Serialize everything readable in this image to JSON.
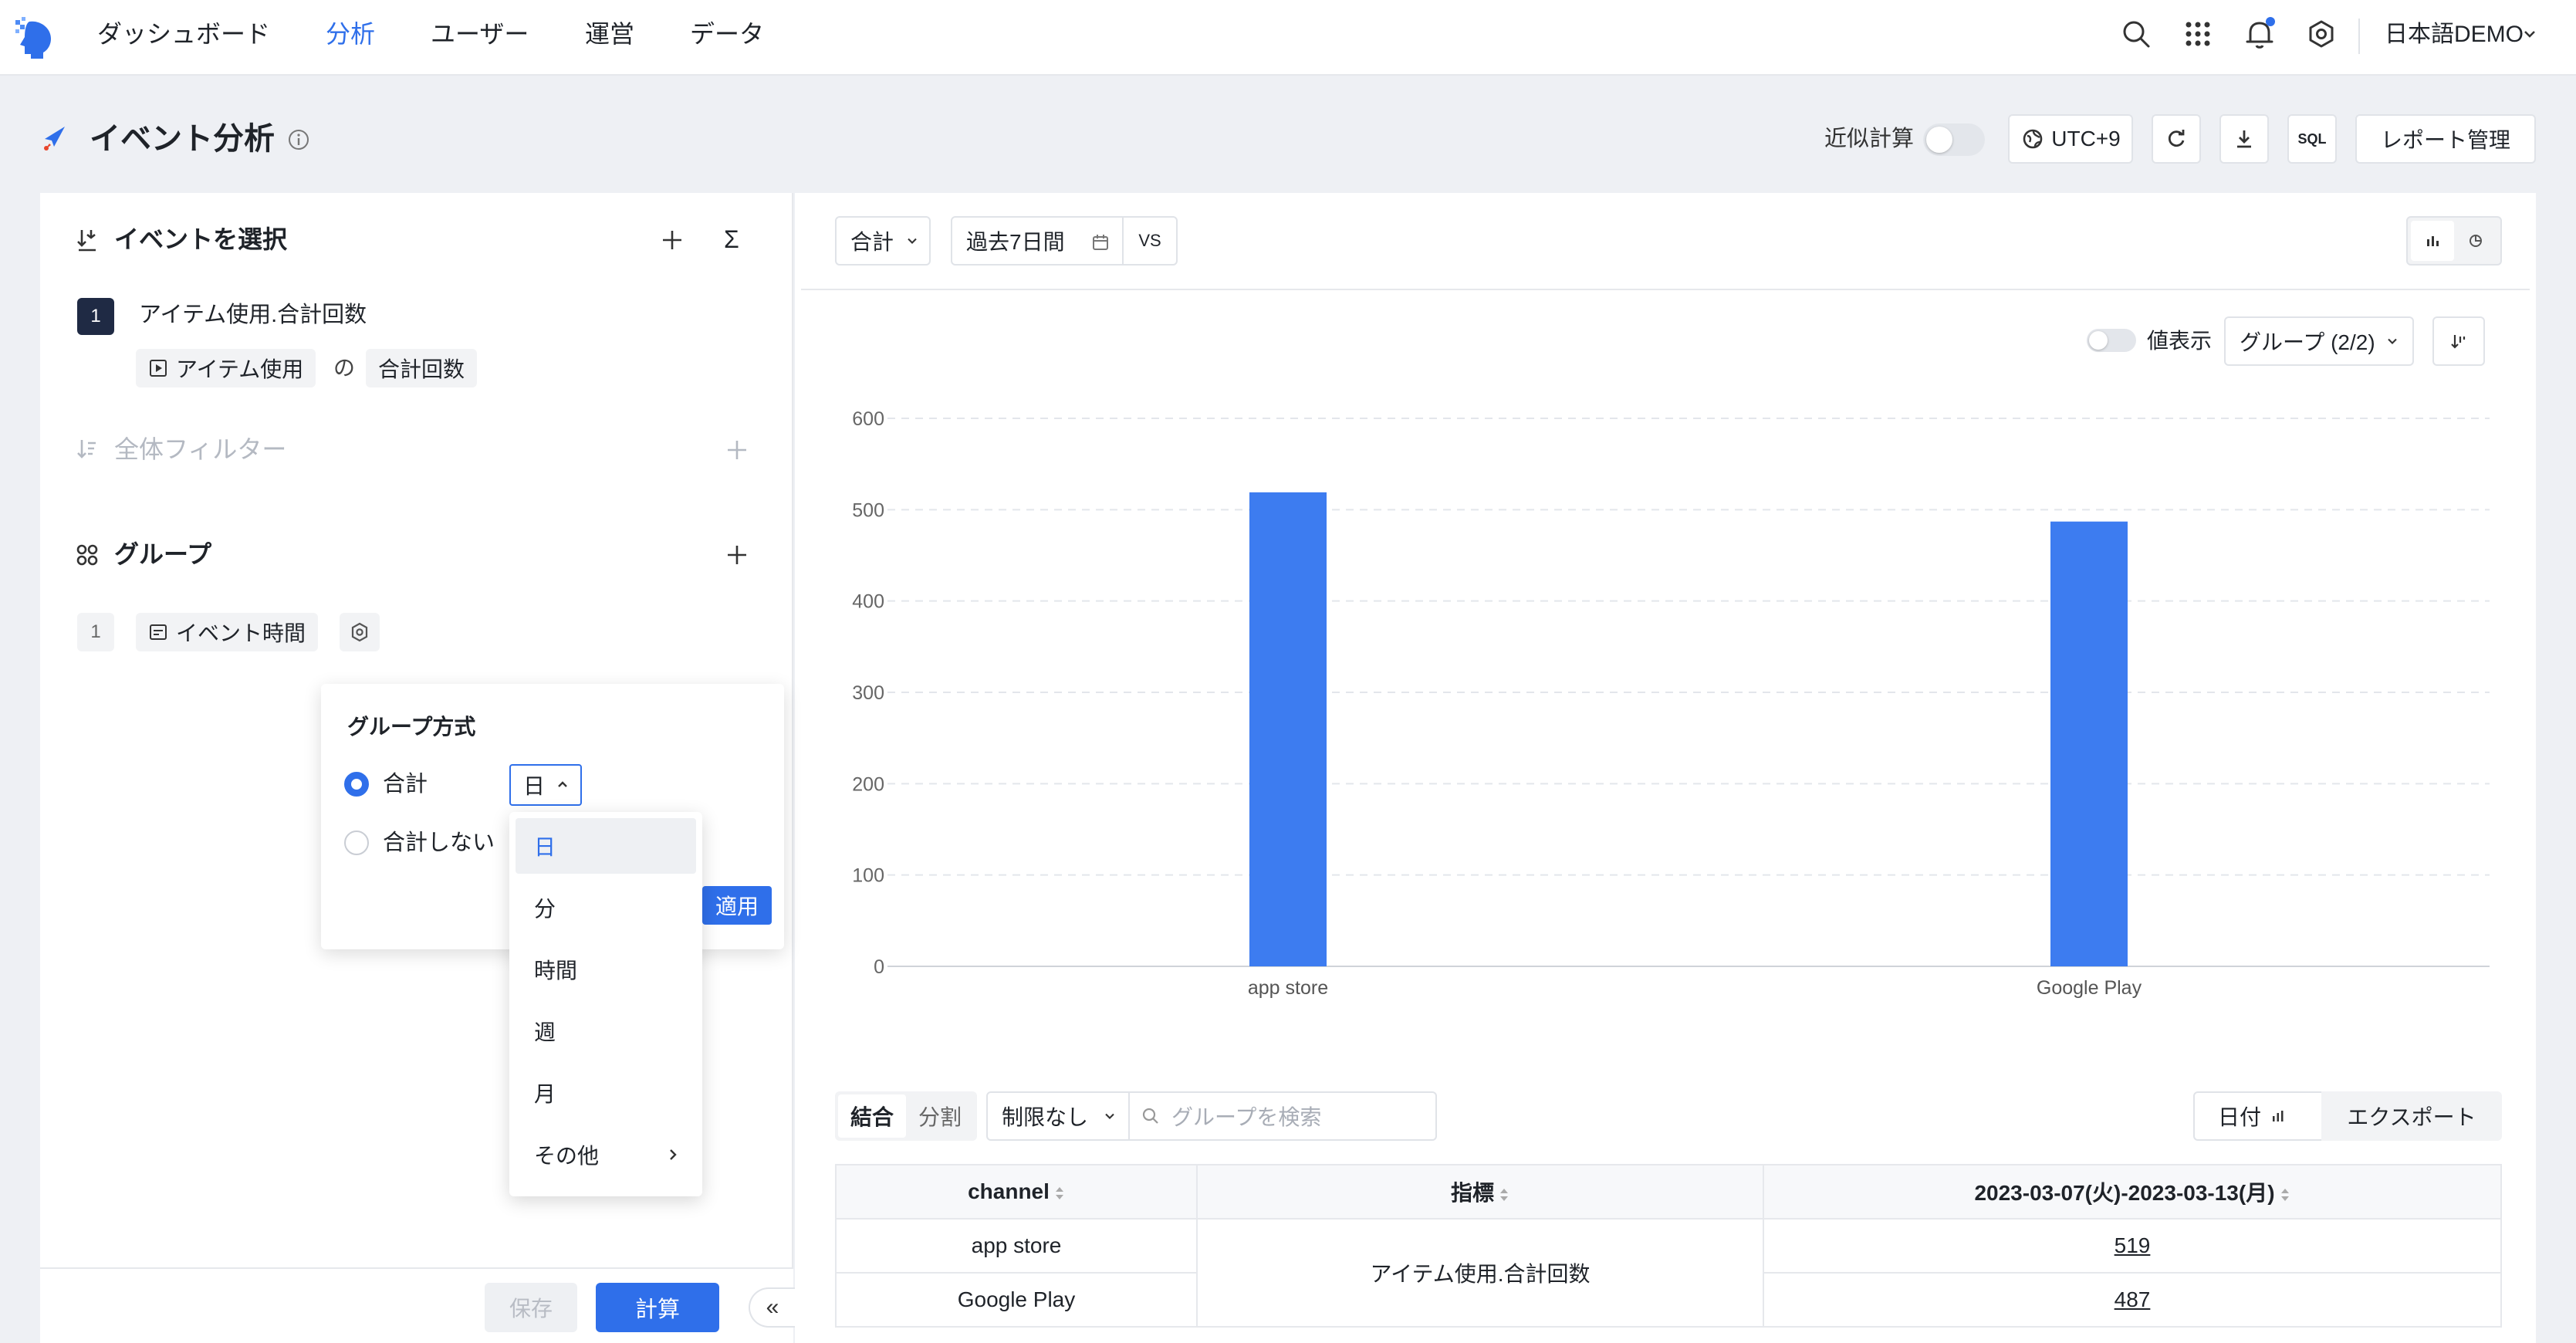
{
  "nav": {
    "items": [
      "ダッシュボード",
      "分析",
      "ユーザー",
      "運営",
      "データ"
    ],
    "active": "分析",
    "user": "日本語DEMO"
  },
  "header": {
    "title": "イベント分析",
    "approx_label": "近似計算",
    "timezone": "UTC+9",
    "sql_label": "SQL",
    "report_button": "レポート管理"
  },
  "left": {
    "event_section_title": "イベントを選択",
    "sigma": "Σ",
    "event": {
      "number": "1",
      "name": "アイテム使用.合計回数",
      "event_chip": "アイテム使用",
      "of": "の",
      "metric_chip": "合計回数"
    },
    "filter_title": "全体フィルター",
    "group_title": "グループ",
    "group": {
      "number": "1",
      "chip": "イベント時間"
    },
    "save_button": "保存",
    "calc_button": "計算",
    "collapse_label": "«"
  },
  "popover": {
    "title": "グループ方式",
    "option_total": "合計",
    "option_no_total": "合計しない",
    "unit_selected": "日",
    "apply_button": "適用",
    "dropdown": [
      "日",
      "分",
      "時間",
      "週",
      "月",
      "その他"
    ]
  },
  "toolbar": {
    "aggregate": "合計",
    "date_range": "過去7日間",
    "vs": "VS",
    "value_display": "値表示",
    "group_select": "グループ (2/2)"
  },
  "chart_data": {
    "type": "bar",
    "categories": [
      "app store",
      "Google Play"
    ],
    "values": [
      519,
      487
    ],
    "yticks": [
      0,
      100,
      200,
      300,
      400,
      500,
      600
    ],
    "ylim": [
      0,
      600
    ],
    "color": "#3d7cf0",
    "grid": true
  },
  "table_controls": {
    "seg_merge": "結合",
    "seg_split": "分割",
    "limit": "制限なし",
    "search_placeholder": "グループを検索",
    "date_button": "日付",
    "export_button": "エクスポート"
  },
  "table": {
    "headers": [
      "channel",
      "指標",
      "2023-03-07(火)-2023-03-13(月)"
    ],
    "metric": "アイテム使用.合計回数",
    "rows": [
      {
        "channel": "app store",
        "value": "519"
      },
      {
        "channel": "Google Play",
        "value": "487"
      }
    ]
  }
}
